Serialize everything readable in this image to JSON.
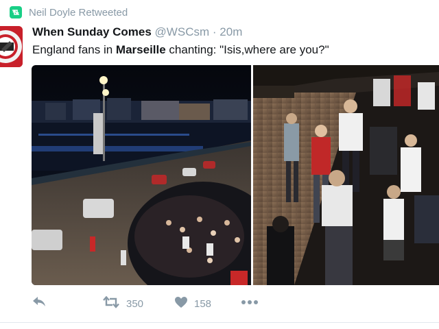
{
  "retweet": {
    "label": "Neil Doyle Retweeted",
    "icon": "retweet-badge-icon"
  },
  "tweet": {
    "display_name": "When Sunday Comes",
    "handle": "@WSCsm",
    "separator": "·",
    "time": "20m",
    "text_part1": "England fans in ",
    "text_bold": "Marseille",
    "text_part2": " chanting: \"Isis,where are you?\""
  },
  "actions": {
    "reply_icon": "reply-icon",
    "retweet_icon": "retweet-icon",
    "retweet_count": "350",
    "like_icon": "heart-icon",
    "like_count": "158",
    "more_icon": "more-icon"
  },
  "colors": {
    "retweet_green": "#19cf86",
    "muted_gray": "#8899a6",
    "text_dark": "#14171a"
  }
}
